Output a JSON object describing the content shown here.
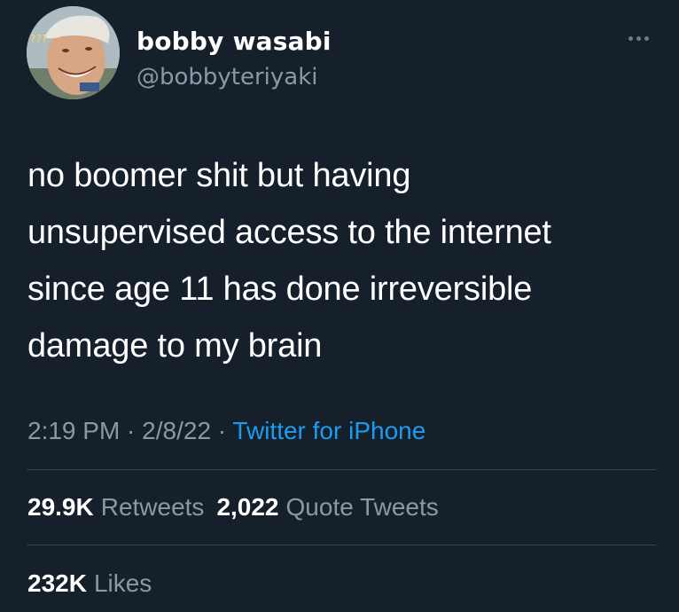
{
  "user": {
    "display_name": "bobby wasabi",
    "handle": "@bobbyteriyaki",
    "avatar_caption": "???"
  },
  "tweet": {
    "text": "no boomer shit but having\nunsupervised access to the internet\nsince age 11 has done irreversible\ndamage to my brain",
    "time": "2:19 PM",
    "date": "2/8/22",
    "separator": " · ",
    "source": "Twitter for iPhone"
  },
  "stats": {
    "retweets_count": "29.9K",
    "retweets_label": "Retweets",
    "quote_count": "2,022",
    "quote_label": "Quote Tweets",
    "likes_count": "232K",
    "likes_label": "Likes"
  },
  "colors": {
    "background": "#15202b",
    "text_primary": "#ffffff",
    "text_secondary": "#8b98a5",
    "link": "#1d9bf0",
    "divider": "#38444d"
  },
  "icons": {
    "more": "more-horizontal-icon"
  }
}
